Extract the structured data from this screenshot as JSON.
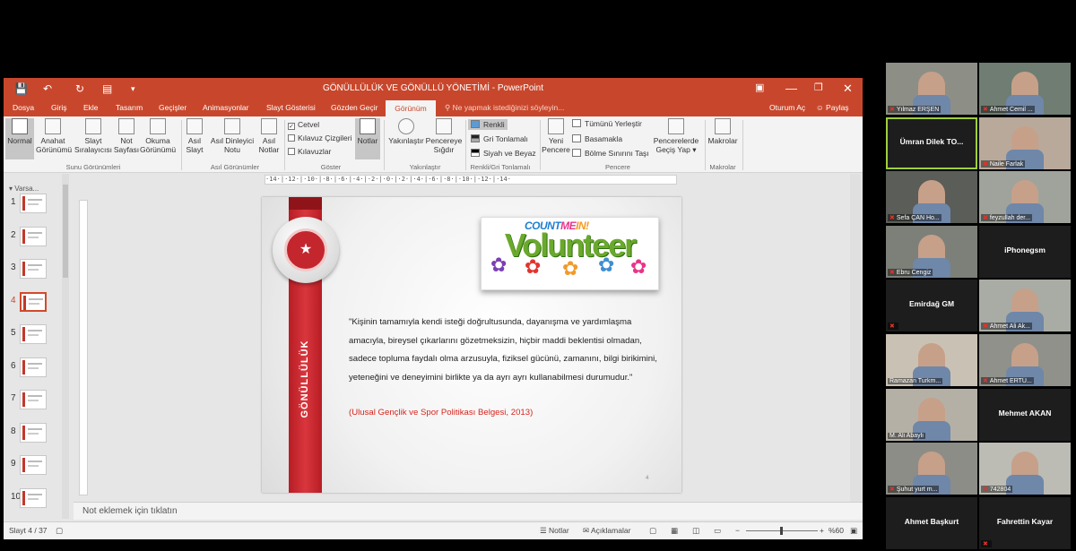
{
  "powerpoint": {
    "doc_title": "GÖNÜLLÜLÜK VE GÖNÜLLÜ YÖNETİMİ - PowerPoint",
    "tabs": [
      "Dosya",
      "Giriş",
      "Ekle",
      "Tasarım",
      "Geçişler",
      "Animasyonlar",
      "Slayt Gösterisi",
      "Gözden Geçir",
      "Görünüm"
    ],
    "tell_me": "Ne yapmak istediğinizi söyleyin...",
    "sign_in": "Oturum Aç",
    "share": "Paylaş",
    "ribbon": {
      "presentation_views": {
        "label": "Sunu Görünümleri",
        "normal": "Normal",
        "outline": [
          "Anahat",
          "Görünümü"
        ],
        "slide_sorter": [
          "Slayt",
          "Sıralayıcısı"
        ],
        "notes_page": [
          "Not",
          "Sayfası"
        ],
        "reading": [
          "Okuma",
          "Görünümü"
        ]
      },
      "master_views": {
        "label": "Asıl Görünümler",
        "slide_master": [
          "Asıl",
          "Slayt"
        ],
        "handout_master": [
          "Asıl Dinleyici",
          "Notu"
        ],
        "notes_master": [
          "Asıl",
          "Notlar"
        ]
      },
      "show": {
        "label": "Göster",
        "ruler": "Cetvel",
        "gridlines": "Kılavuz Çizgileri",
        "guides": "Kılavuzlar",
        "notes": "Notlar"
      },
      "zoom": {
        "label": "Yakınlaştır",
        "zoom": "Yakınlaştır",
        "fit": [
          "Pencereye",
          "Sığdır"
        ]
      },
      "color": {
        "label": "Renkli/Gri Tonlamalı",
        "color": "Renkli",
        "grayscale": "Gri Tonlamalı",
        "bw": "Siyah ve Beyaz"
      },
      "window": {
        "label": "Pencere",
        "new_window": [
          "Yeni",
          "Pencere"
        ],
        "arrange_all": "Tümünü Yerleştir",
        "cascade": "Basamakla",
        "move_split": "Bölme Sınırını Taşı"
      },
      "switch_windows": [
        "Pencerelerde",
        "Geçiş Yap"
      ],
      "macros": {
        "label": "Makrolar",
        "button": "Makrolar"
      }
    },
    "thumbs": {
      "section": "Varsa...",
      "numbers": [
        "1",
        "2",
        "3",
        "4",
        "5",
        "6",
        "7",
        "8",
        "9",
        "10"
      ],
      "active": "4"
    },
    "ruler_text": "·14·|·12·|·10·|·8·|·6·|·4·|·2·|·0·|·2·|·4·|·6·|·8·|·10·|·12·|·14·",
    "slide": {
      "vertical_word": "GÖNÜLLÜLÜK",
      "logo": {
        "count": "COUNT",
        "me": "ME",
        "in": "IN!",
        "word": "Volunteer"
      },
      "quote": "\"Kişinin tamamıyla kendi isteği doğrultusunda, dayanışma ve yardımlaşma amacıyla, bireysel çıkarlarını gözetmeksizin, hiçbir maddi beklentisi olmadan, sadece topluma faydalı olma arzusuyla, fiziksel gücünü, zamanını, bilgi birikimini, yeteneğini ve deneyimini birlikte ya da ayrı ayrı kullanabilmesi durumudur.\"",
      "citation": "(Ulusal Gençlik ve Spor Politikası Belgesi, 2013)",
      "number": "4"
    },
    "notes_placeholder": "Not eklemek için tıklatın",
    "status": {
      "slide_counter": "Slayt 4 / 37",
      "notes": "Notlar",
      "comments": "Açıklamalar",
      "zoom": "%60"
    }
  },
  "participants": [
    {
      "name": "Yılmaz ERŞEN",
      "muted": true,
      "video": true
    },
    {
      "name": "Ahmet Cemil ...",
      "muted": true,
      "video": true
    },
    {
      "name": "Ümran Dilek TO...",
      "muted": false,
      "video": false,
      "speaking": true
    },
    {
      "name": "Naile Farlak",
      "muted": true,
      "video": true
    },
    {
      "name": "Sefa ÇAN Ho...",
      "muted": true,
      "video": true
    },
    {
      "name": "feyzullah der...",
      "muted": true,
      "video": true
    },
    {
      "name": "Ebru Cengiz",
      "muted": true,
      "video": true
    },
    {
      "name": "iPhonegsm",
      "muted": false,
      "video": false
    },
    {
      "name": "Emirdağ GM",
      "muted": true,
      "video": false
    },
    {
      "name": "Ahmet Ali Ak...",
      "muted": true,
      "video": true
    },
    {
      "name": "Ramazan Turkm...",
      "muted": false,
      "video": true
    },
    {
      "name": "Ahmet ERTÜ...",
      "muted": true,
      "video": true
    },
    {
      "name": "M. Ali Abaylı",
      "muted": false,
      "video": true
    },
    {
      "name": "Mehmet AKAN",
      "muted": false,
      "video": false
    },
    {
      "name": "Şuhut yurt m...",
      "muted": true,
      "video": true
    },
    {
      "name": "742804",
      "muted": true,
      "video": true
    },
    {
      "name": "Ahmet Başkurt",
      "muted": false,
      "video": false
    },
    {
      "name": "Fahrettin Kayar",
      "muted": true,
      "video": false
    }
  ],
  "colors": {
    "accent": "#c8472c",
    "slide_red": "#c4262e",
    "speaking": "#9fcf3c"
  }
}
